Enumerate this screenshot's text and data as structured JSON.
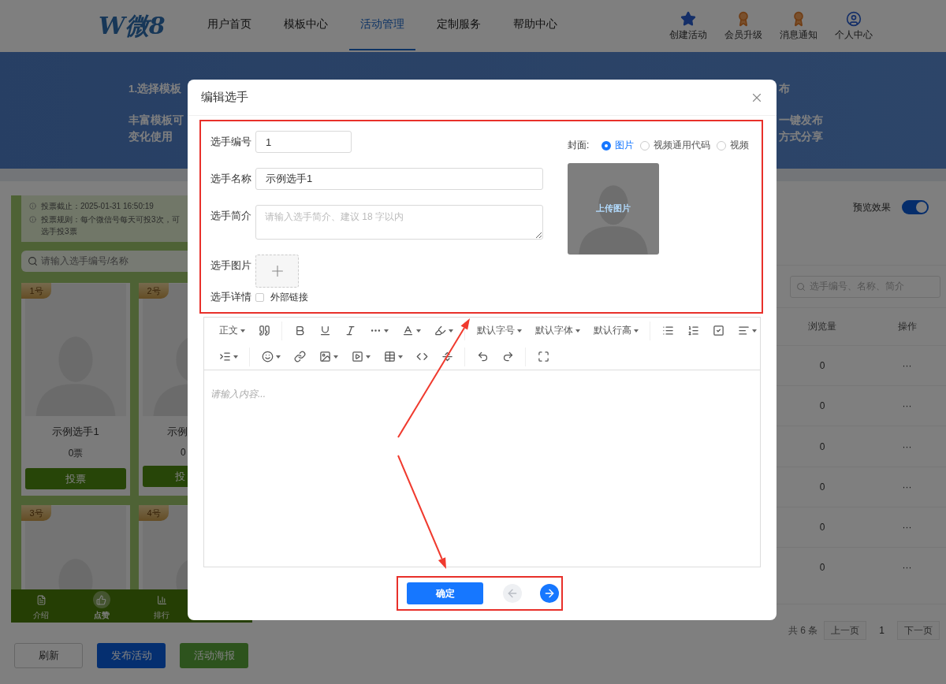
{
  "top_nav": {
    "logo": "W微8",
    "nav_items": [
      {
        "label": "用户首页",
        "selected": false
      },
      {
        "label": "模板中心",
        "selected": false
      },
      {
        "label": "活动管理",
        "selected": true
      },
      {
        "label": "定制服务",
        "selected": false
      },
      {
        "label": "帮助中心",
        "selected": false
      }
    ],
    "shortcuts": [
      {
        "label": "创建活动",
        "kind": "star"
      },
      {
        "label": "会员升级",
        "kind": "badge"
      },
      {
        "label": "消息通知",
        "kind": "badge"
      },
      {
        "label": "个人中心",
        "kind": "user"
      }
    ]
  },
  "banner": {
    "left": {
      "title": "1.选择模板",
      "lines": [
        "丰富模板可",
        "变化使用"
      ]
    },
    "right": {
      "title": "布",
      "lines": [
        "一键发布",
        "方式分享"
      ]
    }
  },
  "phone_preview": {
    "notices": [
      {
        "lines": [
          "投票截止：2025-01-31 16:50:19"
        ]
      },
      {
        "lines": [
          "投票规则：每个微信号每天可投3次，可",
          "选手投3票"
        ]
      }
    ],
    "search": {
      "placeholder": "请输入选手编号/名称"
    },
    "contestants": [
      {
        "badge": "1号",
        "name": "示例选手1",
        "votes": "0票",
        "vote_button": "投票"
      },
      {
        "badge": "2号",
        "name": "示例",
        "votes": "0",
        "vote_button": "投"
      },
      {
        "badge": "3号"
      },
      {
        "badge": "4号"
      }
    ],
    "tab_bar": [
      {
        "label": "介绍",
        "kind": "intro",
        "selected": false
      },
      {
        "label": "点赞",
        "kind": "like",
        "selected": true
      },
      {
        "label": "排行",
        "kind": "rank",
        "selected": false
      }
    ]
  },
  "main_panel": {
    "preview_toggle": {
      "label": "预览效果",
      "on": true
    },
    "search": {
      "placeholder": "选手编号、名称、简介"
    },
    "table": {
      "columns": [
        "浏览量",
        "操作"
      ],
      "rows": [
        {
          "views": "0",
          "actions": "···"
        },
        {
          "views": "0",
          "actions": "···"
        },
        {
          "views": "0",
          "actions": "···"
        },
        {
          "views": "0",
          "actions": "···"
        },
        {
          "views": "0",
          "actions": "···"
        },
        {
          "views": "0",
          "actions": "···"
        }
      ]
    },
    "pagination": {
      "total": "共 6 条",
      "prev": "上一页",
      "page": "1",
      "next": "下一页"
    }
  },
  "actions": [
    {
      "label": "刷新",
      "kind": "default"
    },
    {
      "label": "发布活动",
      "kind": "primary"
    },
    {
      "label": "活动海报",
      "kind": "success"
    }
  ],
  "dialog": {
    "title": "编辑选手",
    "fields": [
      {
        "label": "选手编号",
        "kind": "input",
        "value": "1"
      },
      {
        "label": "选手名称",
        "kind": "input",
        "value": "示例选手1"
      },
      {
        "label": "选手简介",
        "kind": "textarea",
        "placeholder": "请输入选手简介、建议 18 字以内"
      },
      {
        "label": "选手图片",
        "kind": "upload"
      },
      {
        "label": "选手详情",
        "kind": "checkbox",
        "option": "外部链接",
        "checked": false
      }
    ],
    "cover": {
      "label": "封面:",
      "options": [
        {
          "label": "图片",
          "selected": true
        },
        {
          "label": "视频通用代码",
          "selected": false
        },
        {
          "label": "视频",
          "selected": false
        }
      ],
      "upload_text": "上传图片"
    },
    "editor": {
      "text_menus": [
        "正文",
        "默认字号",
        "默认字体",
        "默认行高"
      ],
      "placeholder": "请输入内容..."
    },
    "footer": {
      "confirm": "确定",
      "nav_buttons": [
        {
          "kind": "prev",
          "disabled": true
        },
        {
          "kind": "next",
          "disabled": false
        }
      ]
    }
  }
}
